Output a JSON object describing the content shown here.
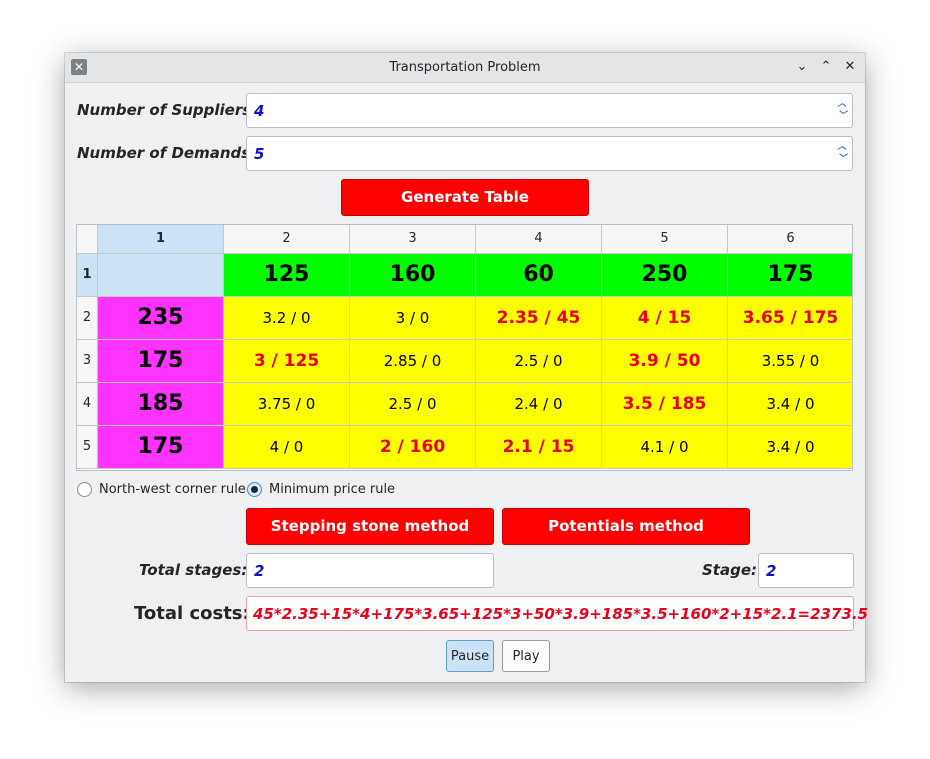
{
  "window": {
    "title": "Transportation Problem"
  },
  "suppliers": {
    "label": "Number of Suppliers:",
    "value": "4"
  },
  "demands": {
    "label": "Number of Demands:",
    "value": "5"
  },
  "generate_button": "Generate Table",
  "table": {
    "column_headers": [
      "1",
      "2",
      "3",
      "4",
      "5",
      "6"
    ],
    "row_headers": [
      "1",
      "2",
      "3",
      "4",
      "5"
    ],
    "demand_values": [
      "125",
      "160",
      "60",
      "250",
      "175"
    ],
    "supplies": [
      "235",
      "175",
      "185",
      "175"
    ],
    "cells": [
      [
        {
          "text": "3.2 / 0",
          "alloc": false
        },
        {
          "text": "3 / 0",
          "alloc": false
        },
        {
          "text": "2.35 / 45",
          "alloc": true
        },
        {
          "text": "4 / 15",
          "alloc": true
        },
        {
          "text": "3.65 / 175",
          "alloc": true
        }
      ],
      [
        {
          "text": "3 / 125",
          "alloc": true
        },
        {
          "text": "2.85 / 0",
          "alloc": false
        },
        {
          "text": "2.5 / 0",
          "alloc": false
        },
        {
          "text": "3.9 / 50",
          "alloc": true
        },
        {
          "text": "3.55 / 0",
          "alloc": false
        }
      ],
      [
        {
          "text": "3.75 / 0",
          "alloc": false
        },
        {
          "text": "2.5 / 0",
          "alloc": false
        },
        {
          "text": "2.4 / 0",
          "alloc": false
        },
        {
          "text": "3.5 / 185",
          "alloc": true
        },
        {
          "text": "3.4 / 0",
          "alloc": false
        }
      ],
      [
        {
          "text": "4 / 0",
          "alloc": false
        },
        {
          "text": "2 / 160",
          "alloc": true
        },
        {
          "text": "2.1 / 15",
          "alloc": true
        },
        {
          "text": "4.1 / 0",
          "alloc": false
        },
        {
          "text": "3.4 / 0",
          "alloc": false
        }
      ]
    ]
  },
  "rules": [
    {
      "label": "North-west corner rule",
      "selected": false
    },
    {
      "label": "Minimum price rule",
      "selected": true
    }
  ],
  "methods": {
    "stepping_stone": "Stepping stone method",
    "potentials": "Potentials method"
  },
  "total_stages": {
    "label": "Total stages:",
    "value": "2"
  },
  "stage": {
    "label": "Stage:",
    "value": "2"
  },
  "total_costs": {
    "label": "Total costs:",
    "value": "45*2.35+15*4+175*3.65+125*3+50*3.9+185*3.5+160*2+15*2.1=2373.5"
  },
  "playback": {
    "pause": "Pause",
    "play": "Play"
  },
  "colors": {
    "accent": "#ff0000",
    "demand_bg": "#00ff00",
    "supply_bg": "#ff33ff",
    "cost_bg": "#ffff00",
    "alloc_text": "#e8001c",
    "value_text": "#1010c8"
  },
  "icons": {
    "app": "x-app-icon",
    "minimize": "chevron-down-icon",
    "maximize": "chevron-up-icon",
    "close": "close-icon",
    "spin": "spin-arrows-icon"
  }
}
